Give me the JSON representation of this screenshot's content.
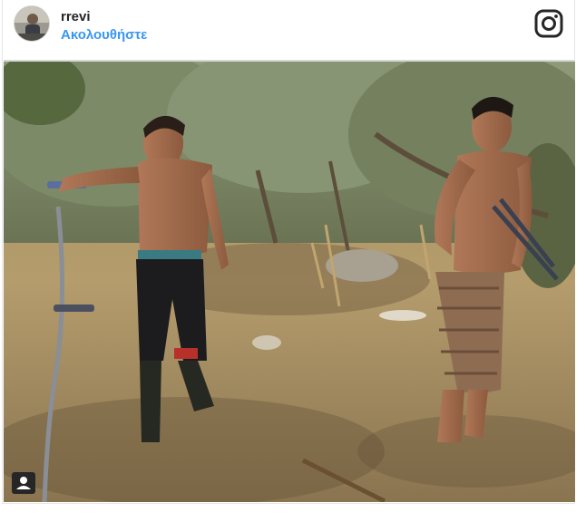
{
  "post": {
    "username": "rrevi",
    "follow_label": "Ακολουθήστε"
  },
  "icons": {
    "brand": "instagram-logo-icon",
    "tag": "user-tag-icon"
  },
  "colors": {
    "follow_link": "#3897f0",
    "username": "#262626"
  },
  "photo": {
    "subject": "two shirtless men in an olive grove holding garden tools"
  }
}
